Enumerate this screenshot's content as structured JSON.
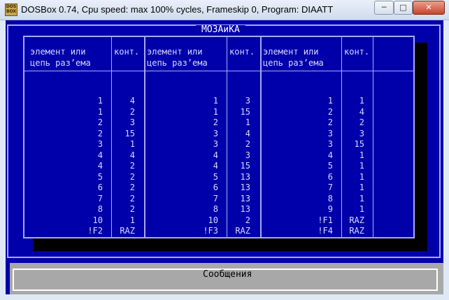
{
  "window": {
    "title": "DOSBox 0.74, Cpu speed: max 100% cycles, Frameskip  0, Program:   DIAATT",
    "icon": "dosbox-icon"
  },
  "controls": {
    "minimize": "─",
    "maximize": "□",
    "close": "✕"
  },
  "panel": {
    "title": "МОЗАиКА"
  },
  "columns": [
    {
      "header1": "элемент или",
      "header2": "цепь раз’ема",
      "contact_header": "конт."
    },
    {
      "header1": "элемент или",
      "header2": "цепь раз’ема",
      "contact_header": "конт."
    },
    {
      "header1": "элемент или",
      "header2": "цепь раз’ема",
      "contact_header": "конт."
    }
  ],
  "table": {
    "group1": [
      [
        "1",
        "4"
      ],
      [
        "1",
        "2"
      ],
      [
        "2",
        "3"
      ],
      [
        "2",
        "15"
      ],
      [
        "3",
        "1"
      ],
      [
        "4",
        "4"
      ],
      [
        "4",
        "2"
      ],
      [
        "5",
        "2"
      ],
      [
        "6",
        "2"
      ],
      [
        "7",
        "2"
      ],
      [
        "8",
        "2"
      ],
      [
        "10",
        "1"
      ],
      [
        "!F2",
        "RAZ"
      ]
    ],
    "group2": [
      [
        "1",
        "3"
      ],
      [
        "1",
        "15"
      ],
      [
        "2",
        "1"
      ],
      [
        "3",
        "4"
      ],
      [
        "3",
        "2"
      ],
      [
        "4",
        "3"
      ],
      [
        "4",
        "15"
      ],
      [
        "5",
        "13"
      ],
      [
        "6",
        "13"
      ],
      [
        "7",
        "13"
      ],
      [
        "8",
        "13"
      ],
      [
        "10",
        "2"
      ],
      [
        "!F3",
        "RAZ"
      ]
    ],
    "group3": [
      [
        "1",
        "1"
      ],
      [
        "2",
        "4"
      ],
      [
        "2",
        "2"
      ],
      [
        "3",
        "3"
      ],
      [
        "3",
        "15"
      ],
      [
        "4",
        "1"
      ],
      [
        "5",
        "1"
      ],
      [
        "6",
        "1"
      ],
      [
        "7",
        "1"
      ],
      [
        "8",
        "1"
      ],
      [
        "9",
        "1"
      ],
      [
        "!F1",
        "RAZ"
      ],
      [
        "!F4",
        "RAZ"
      ]
    ]
  },
  "messages": {
    "title": "Сообщения"
  }
}
